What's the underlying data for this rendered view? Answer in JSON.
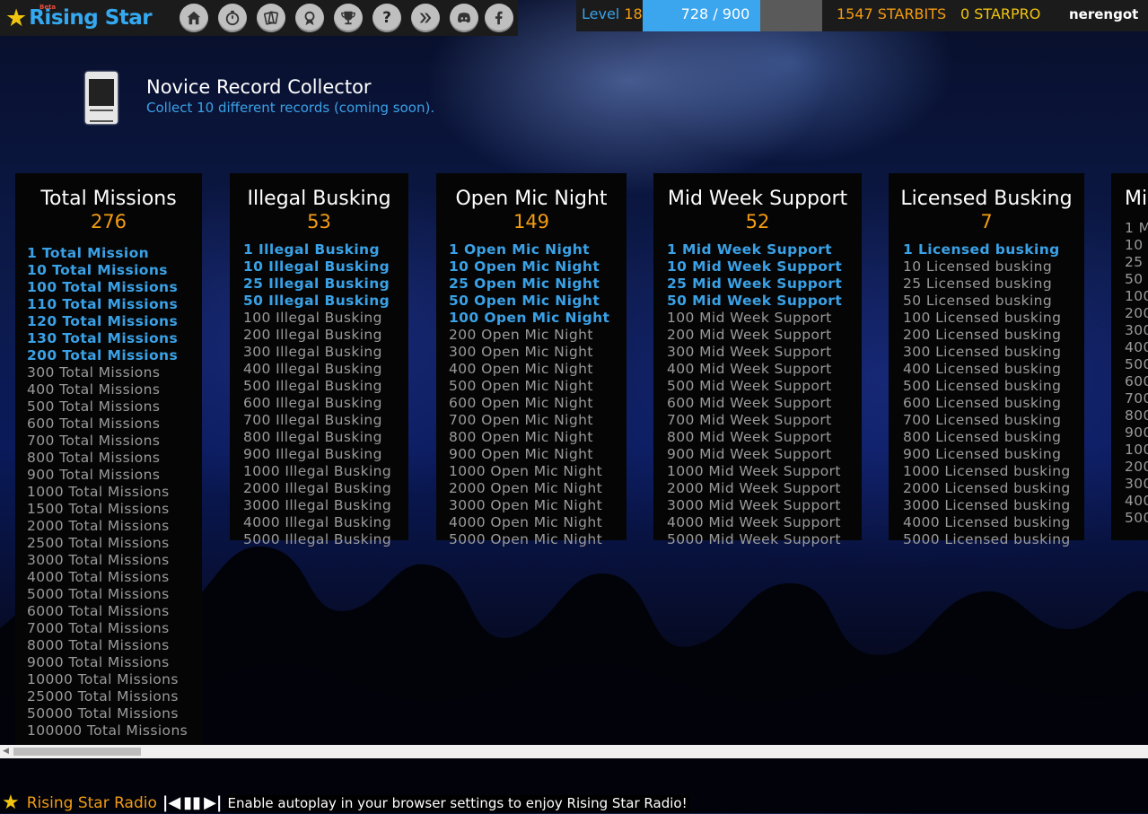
{
  "brand": {
    "name": "Rising Star",
    "beta": "Beta"
  },
  "nav": [
    {
      "name": "home-icon"
    },
    {
      "name": "stopwatch-icon"
    },
    {
      "name": "cards-icon"
    },
    {
      "name": "award-icon"
    },
    {
      "name": "trophy-icon"
    },
    {
      "name": "help-icon"
    },
    {
      "name": "hive-icon"
    },
    {
      "name": "discord-icon"
    },
    {
      "name": "facebook-icon"
    }
  ],
  "status": {
    "level_label": "Level",
    "level": "18",
    "xp_text": "728 / 900",
    "xp_progress": 0.809,
    "starbits": "1547 STARBITS",
    "starpro": "0 STARPRO",
    "username": "nerengot"
  },
  "achievement": {
    "title": "Novice Record Collector",
    "description": "Collect 10 different records (coming soon)."
  },
  "columns": [
    {
      "title": "Total Missions",
      "count": "276",
      "items": [
        {
          "t": "1 Total Mission",
          "d": true
        },
        {
          "t": "10 Total Missions",
          "d": true
        },
        {
          "t": "100 Total Missions",
          "d": true
        },
        {
          "t": "110 Total Missions",
          "d": true
        },
        {
          "t": "120 Total Missions",
          "d": true
        },
        {
          "t": "130 Total Missions",
          "d": true
        },
        {
          "t": "200 Total Missions",
          "d": true
        },
        {
          "t": "300 Total Missions",
          "d": false
        },
        {
          "t": "400 Total Missions",
          "d": false
        },
        {
          "t": "500 Total Missions",
          "d": false
        },
        {
          "t": "600 Total Missions",
          "d": false
        },
        {
          "t": "700 Total Missions",
          "d": false
        },
        {
          "t": "800 Total Missions",
          "d": false
        },
        {
          "t": "900 Total Missions",
          "d": false
        },
        {
          "t": "1000 Total Missions",
          "d": false
        },
        {
          "t": "1500 Total Missions",
          "d": false
        },
        {
          "t": "2000 Total Missions",
          "d": false
        },
        {
          "t": "2500 Total Missions",
          "d": false
        },
        {
          "t": "3000 Total Missions",
          "d": false
        },
        {
          "t": "4000 Total Missions",
          "d": false
        },
        {
          "t": "5000 Total Missions",
          "d": false
        },
        {
          "t": "6000 Total Missions",
          "d": false
        },
        {
          "t": "7000 Total Missions",
          "d": false
        },
        {
          "t": "8000 Total Missions",
          "d": false
        },
        {
          "t": "9000 Total Missions",
          "d": false
        },
        {
          "t": "10000 Total Missions",
          "d": false
        },
        {
          "t": "25000 Total Missions",
          "d": false
        },
        {
          "t": "50000 Total Missions",
          "d": false
        },
        {
          "t": "100000 Total Missions",
          "d": false
        }
      ]
    },
    {
      "title": "Illegal Busking",
      "count": "53",
      "items": [
        {
          "t": "1 Illegal Busking",
          "d": true
        },
        {
          "t": "10 Illegal Busking",
          "d": true
        },
        {
          "t": "25 Illegal Busking",
          "d": true
        },
        {
          "t": "50 Illegal Busking",
          "d": true
        },
        {
          "t": "100 Illegal Busking",
          "d": false
        },
        {
          "t": "200 Illegal Busking",
          "d": false
        },
        {
          "t": "300 Illegal Busking",
          "d": false
        },
        {
          "t": "400 Illegal Busking",
          "d": false
        },
        {
          "t": "500 Illegal Busking",
          "d": false
        },
        {
          "t": "600 Illegal Busking",
          "d": false
        },
        {
          "t": "700 Illegal Busking",
          "d": false
        },
        {
          "t": "800 Illegal Busking",
          "d": false
        },
        {
          "t": "900 Illegal Busking",
          "d": false
        },
        {
          "t": "1000 Illegal Busking",
          "d": false
        },
        {
          "t": "2000 Illegal Busking",
          "d": false
        },
        {
          "t": "3000 Illegal Busking",
          "d": false
        },
        {
          "t": "4000 Illegal Busking",
          "d": false
        },
        {
          "t": "5000 Illegal Busking",
          "d": false
        }
      ]
    },
    {
      "title": "Open Mic Night",
      "count": "149",
      "items": [
        {
          "t": "1 Open Mic Night",
          "d": true
        },
        {
          "t": "10 Open Mic Night",
          "d": true
        },
        {
          "t": "25 Open Mic Night",
          "d": true
        },
        {
          "t": "50 Open Mic Night",
          "d": true
        },
        {
          "t": "100 Open Mic Night",
          "d": true
        },
        {
          "t": "200 Open Mic Night",
          "d": false
        },
        {
          "t": "300 Open Mic Night",
          "d": false
        },
        {
          "t": "400 Open Mic Night",
          "d": false
        },
        {
          "t": "500 Open Mic Night",
          "d": false
        },
        {
          "t": "600 Open Mic Night",
          "d": false
        },
        {
          "t": "700 Open Mic Night",
          "d": false
        },
        {
          "t": "800 Open Mic Night",
          "d": false
        },
        {
          "t": "900 Open Mic Night",
          "d": false
        },
        {
          "t": "1000 Open Mic Night",
          "d": false
        },
        {
          "t": "2000 Open Mic Night",
          "d": false
        },
        {
          "t": "3000 Open Mic Night",
          "d": false
        },
        {
          "t": "4000 Open Mic Night",
          "d": false
        },
        {
          "t": "5000 Open Mic Night",
          "d": false
        }
      ]
    },
    {
      "title": "Mid Week Support",
      "count": "52",
      "items": [
        {
          "t": "1 Mid Week Support",
          "d": true
        },
        {
          "t": "10 Mid Week Support",
          "d": true
        },
        {
          "t": "25 Mid Week Support",
          "d": true
        },
        {
          "t": "50 Mid Week Support",
          "d": true
        },
        {
          "t": "100 Mid Week Support",
          "d": false
        },
        {
          "t": "200 Mid Week Support",
          "d": false
        },
        {
          "t": "300 Mid Week Support",
          "d": false
        },
        {
          "t": "400 Mid Week Support",
          "d": false
        },
        {
          "t": "500 Mid Week Support",
          "d": false
        },
        {
          "t": "600 Mid Week Support",
          "d": false
        },
        {
          "t": "700 Mid Week Support",
          "d": false
        },
        {
          "t": "800 Mid Week Support",
          "d": false
        },
        {
          "t": "900 Mid Week Support",
          "d": false
        },
        {
          "t": "1000 Mid Week Support",
          "d": false
        },
        {
          "t": "2000 Mid Week Support",
          "d": false
        },
        {
          "t": "3000 Mid Week Support",
          "d": false
        },
        {
          "t": "4000 Mid Week Support",
          "d": false
        },
        {
          "t": "5000 Mid Week Support",
          "d": false
        }
      ]
    },
    {
      "title": "Licensed Busking",
      "count": "7",
      "items": [
        {
          "t": "1 Licensed busking",
          "d": true
        },
        {
          "t": "10 Licensed busking",
          "d": false
        },
        {
          "t": "25 Licensed busking",
          "d": false
        },
        {
          "t": "50 Licensed busking",
          "d": false
        },
        {
          "t": "100 Licensed busking",
          "d": false
        },
        {
          "t": "200 Licensed busking",
          "d": false
        },
        {
          "t": "300 Licensed busking",
          "d": false
        },
        {
          "t": "400 Licensed busking",
          "d": false
        },
        {
          "t": "500 Licensed busking",
          "d": false
        },
        {
          "t": "600 Licensed busking",
          "d": false
        },
        {
          "t": "700 Licensed busking",
          "d": false
        },
        {
          "t": "800 Licensed busking",
          "d": false
        },
        {
          "t": "900 Licensed busking",
          "d": false
        },
        {
          "t": "1000 Licensed busking",
          "d": false
        },
        {
          "t": "2000 Licensed busking",
          "d": false
        },
        {
          "t": "3000 Licensed busking",
          "d": false
        },
        {
          "t": "4000 Licensed busking",
          "d": false
        },
        {
          "t": "5000 Licensed busking",
          "d": false
        }
      ]
    },
    {
      "title": "Mi",
      "count": "",
      "items": [
        {
          "t": "1 M",
          "d": false
        },
        {
          "t": "10",
          "d": false
        },
        {
          "t": "25",
          "d": false
        },
        {
          "t": "50",
          "d": false
        },
        {
          "t": "100",
          "d": false
        },
        {
          "t": "200",
          "d": false
        },
        {
          "t": "300",
          "d": false
        },
        {
          "t": "400",
          "d": false
        },
        {
          "t": "500",
          "d": false
        },
        {
          "t": "600",
          "d": false
        },
        {
          "t": "700",
          "d": false
        },
        {
          "t": "800",
          "d": false
        },
        {
          "t": "900",
          "d": false
        },
        {
          "t": "100",
          "d": false
        },
        {
          "t": "200",
          "d": false
        },
        {
          "t": "300",
          "d": false
        },
        {
          "t": "400",
          "d": false
        },
        {
          "t": "500",
          "d": false
        }
      ]
    }
  ],
  "radio": {
    "title": "Rising Star Radio",
    "message": "Enable autoplay in your browser settings to enjoy Rising Star Radio!"
  },
  "colors": {
    "accent_blue": "#3aa1e6",
    "accent_orange": "#f39c12",
    "bar_bg": "#1b1b1b"
  }
}
